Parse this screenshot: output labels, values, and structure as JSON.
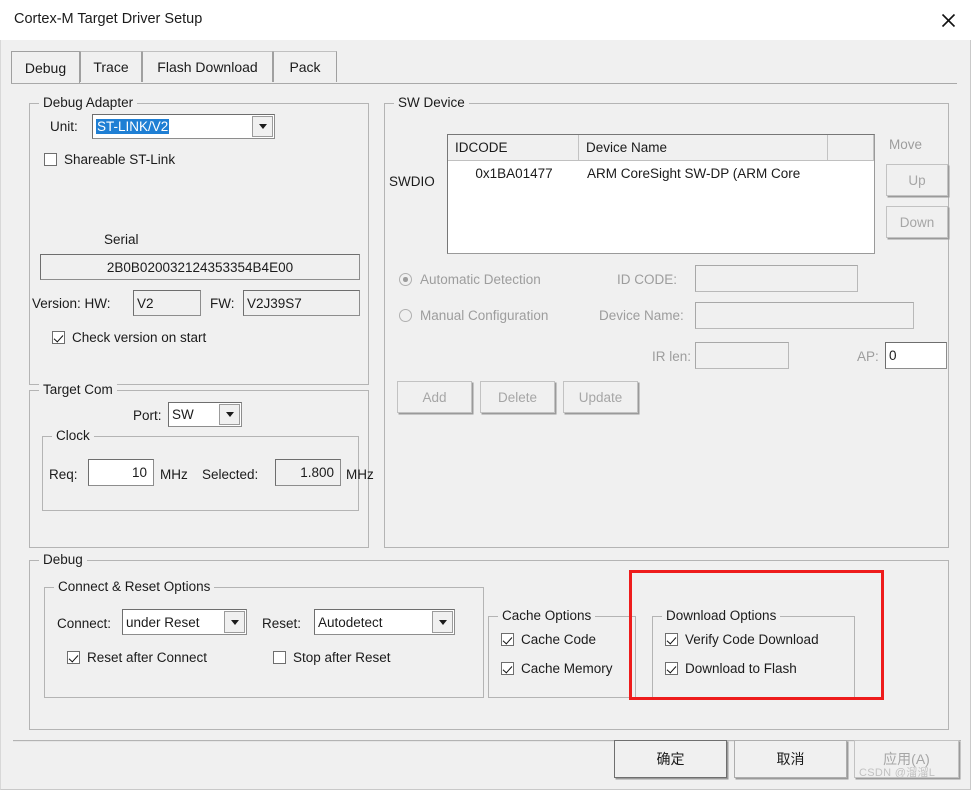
{
  "window": {
    "title": "Cortex-M Target Driver Setup",
    "close_icon": "close-icon"
  },
  "tabs": [
    {
      "label": "Debug",
      "selected": true
    },
    {
      "label": "Trace",
      "selected": false
    },
    {
      "label": "Flash Download",
      "selected": false
    },
    {
      "label": "Pack",
      "selected": false
    }
  ],
  "debug_adapter": {
    "caption": "Debug Adapter",
    "unit_label": "Unit:",
    "unit_value": "ST-LINK/V2",
    "shareable_label": "Shareable ST-Link",
    "shareable_checked": false,
    "serial_label": "Serial",
    "serial_value": "2B0B020032124353354B4E00",
    "version_label": "Version: HW:",
    "hw_value": "V2",
    "fw_label": "FW:",
    "fw_value": "V2J39S7",
    "check_version_label": "Check version on start",
    "check_version_checked": true
  },
  "sw_device": {
    "caption": "SW Device",
    "swdio_label": "SWDIO",
    "columns": [
      "IDCODE",
      "Device Name"
    ],
    "rows": [
      {
        "idcode": "0x1BA01477",
        "name": "ARM CoreSight SW-DP (ARM Core"
      }
    ],
    "move_label": "Move",
    "up_label": "Up",
    "down_label": "Down",
    "automatic_detection_label": "Automatic Detection",
    "automatic_detection_selected": true,
    "manual_configuration_label": "Manual Configuration",
    "manual_configuration_selected": false,
    "id_code_label": "ID CODE:",
    "id_code_value": "",
    "device_name_label": "Device Name:",
    "device_name_value": "",
    "ir_len_label": "IR len:",
    "ir_len_value": "",
    "ap_label": "AP:",
    "ap_value": "0",
    "add_label": "Add",
    "delete_label": "Delete",
    "update_label": "Update"
  },
  "target_com": {
    "caption": "Target Com",
    "port_label": "Port:",
    "port_value": "SW",
    "clock_caption": "Clock",
    "req_label": "Req:",
    "req_value": "10",
    "req_unit": "MHz",
    "selected_label": "Selected:",
    "selected_value": "1.800",
    "selected_unit": "MHz"
  },
  "debug_group": {
    "caption": "Debug",
    "connect_reset": {
      "caption": "Connect & Reset Options",
      "connect_label": "Connect:",
      "connect_value": "under Reset",
      "reset_label": "Reset:",
      "reset_value": "Autodetect",
      "reset_after_connect_label": "Reset after Connect",
      "reset_after_connect_checked": true,
      "stop_after_reset_label": "Stop after Reset",
      "stop_after_reset_checked": false
    },
    "cache_options": {
      "caption": "Cache Options",
      "cache_code_label": "Cache Code",
      "cache_code_checked": true,
      "cache_memory_label": "Cache Memory",
      "cache_memory_checked": true
    },
    "download_options": {
      "caption": "Download Options",
      "verify_code_download_label": "Verify Code Download",
      "verify_code_download_checked": true,
      "download_to_flash_label": "Download to Flash",
      "download_to_flash_checked": true,
      "highlight_color": "#ee1c1c"
    }
  },
  "footer": {
    "ok_label": "确定",
    "cancel_label": "取消",
    "apply_label": "应用(A)",
    "apply_enabled": false,
    "watermark": "CSDN @溜溜L"
  }
}
